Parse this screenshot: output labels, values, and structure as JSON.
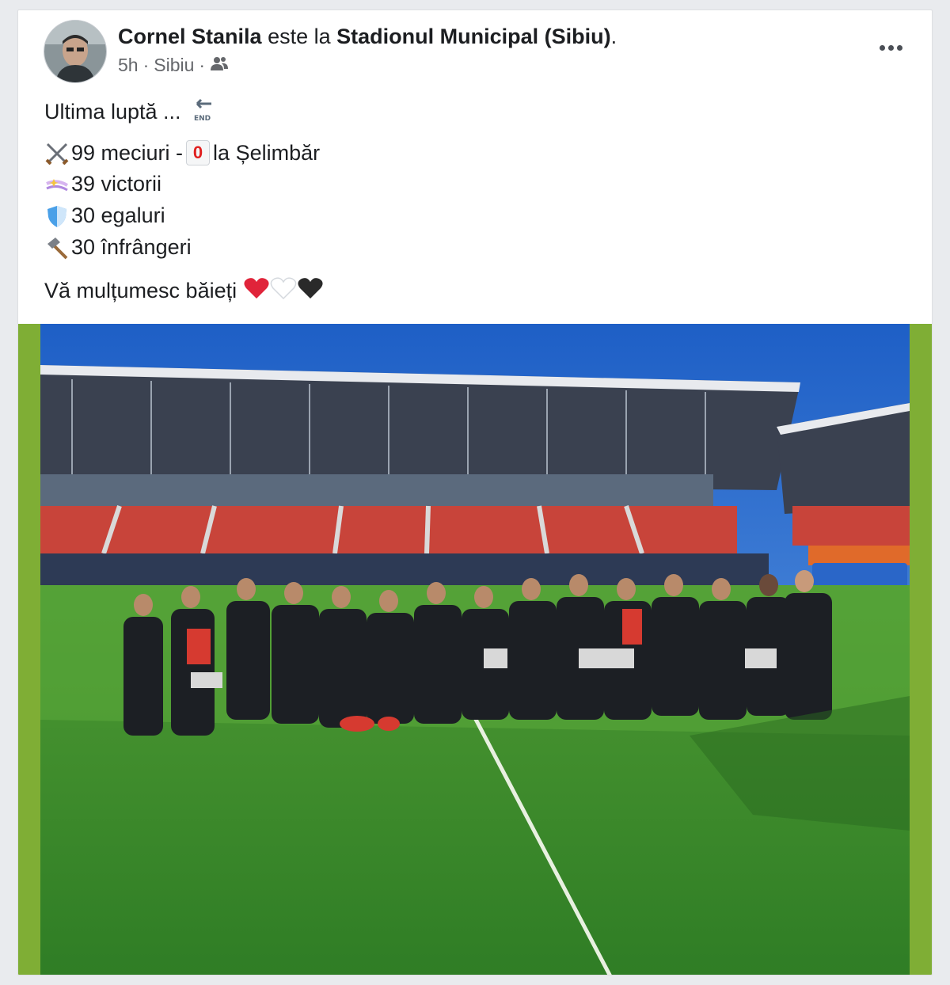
{
  "post": {
    "author": "Cornel Stanila",
    "connector": "este la",
    "place": "Stadionul Municipal (Sibiu)",
    "period": ".",
    "time": "5h",
    "separator": "·",
    "location": "Sibiu",
    "separator2": "·",
    "privacy_icon": "friends-icon",
    "more_icon": "more-options-icon"
  },
  "body": {
    "line1": "Ultima luptă ...",
    "stats": [
      {
        "icon": "crossed-swords-icon",
        "text_before": "99 meciuri - ",
        "badge": "0",
        "text_after": " la Șelimbăr"
      },
      {
        "icon": "sparkles-icon",
        "text": "39 victorii"
      },
      {
        "icon": "shield-icon",
        "text": "30 egaluri"
      },
      {
        "icon": "hammer-icon",
        "text": "30 înfrângeri"
      }
    ],
    "thanks": "Vă mulțumesc băieți"
  },
  "colors": {
    "accent": "#1877f2",
    "photo_frame": "#7fae35",
    "pitch": "#3c8f2c",
    "sky": "#2f6fd0",
    "seats_red": "#c8443a"
  }
}
